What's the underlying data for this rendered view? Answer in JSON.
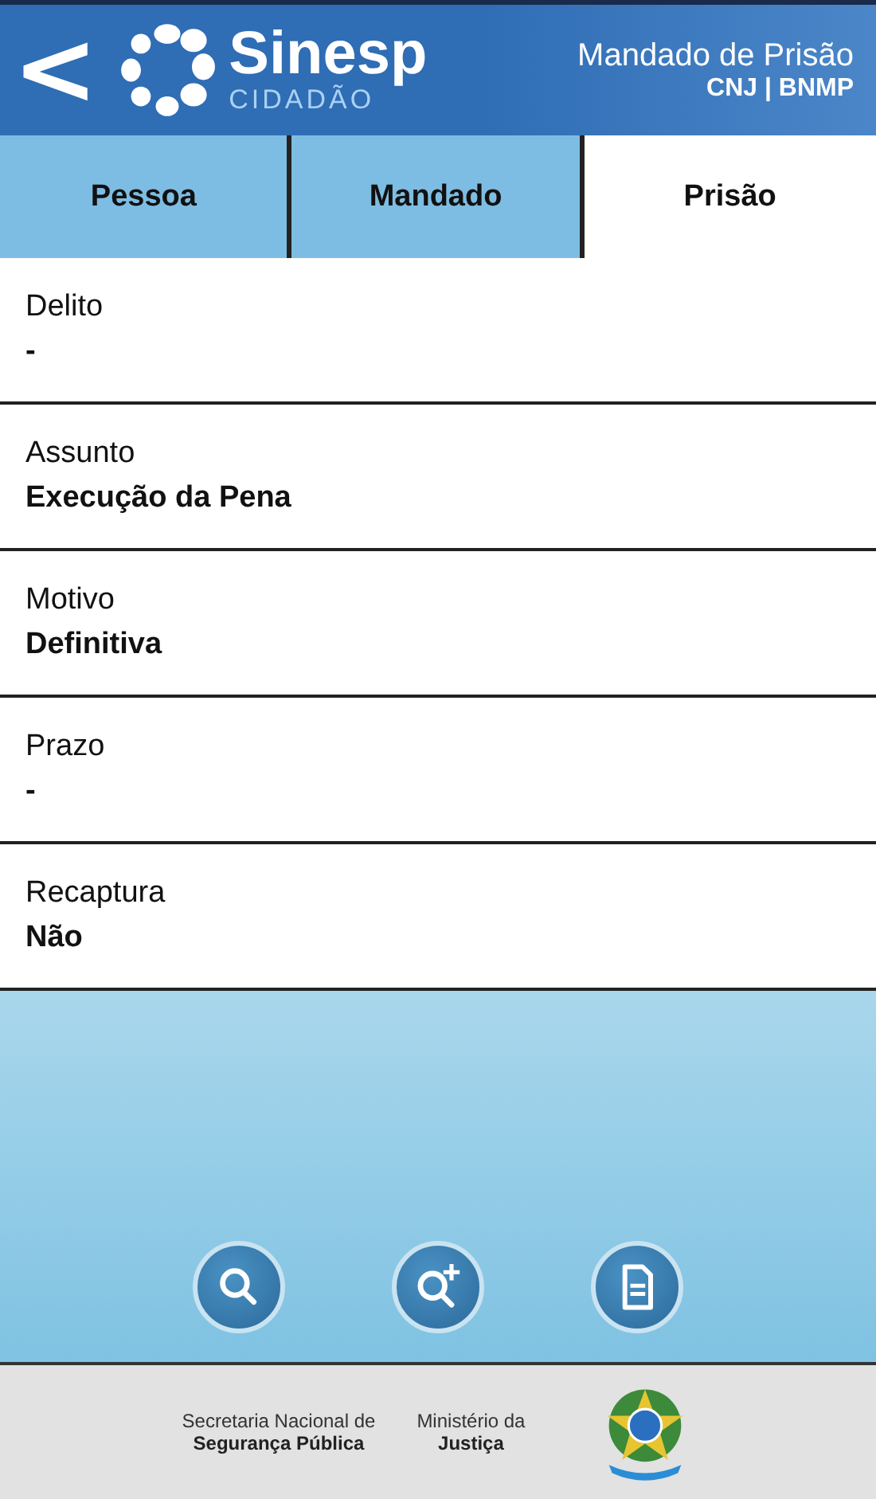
{
  "header": {
    "back": "<",
    "logo_title": "Sinesp",
    "logo_subtitle": "CIDADÃO",
    "title": "Mandado de Prisão",
    "subtitle": "CNJ | BNMP"
  },
  "tabs": [
    {
      "label": "Pessoa",
      "selected": false
    },
    {
      "label": "Mandado",
      "selected": false
    },
    {
      "label": "Prisão",
      "selected": true
    }
  ],
  "fields": [
    {
      "label": "Delito",
      "value": "-"
    },
    {
      "label": "Assunto",
      "value": "Execução da Pena"
    },
    {
      "label": "Motivo",
      "value": "Definitiva"
    },
    {
      "label": "Prazo",
      "value": "-"
    },
    {
      "label": "Recaptura",
      "value": "Não"
    }
  ],
  "actions": [
    {
      "kind": "search"
    },
    {
      "kind": "search-plus"
    },
    {
      "kind": "document"
    }
  ],
  "footer": {
    "secretaria": [
      "Secretaria Nacional de",
      "Segurança Pública"
    ],
    "ministerio": [
      "Ministério da",
      "Justiça"
    ]
  }
}
